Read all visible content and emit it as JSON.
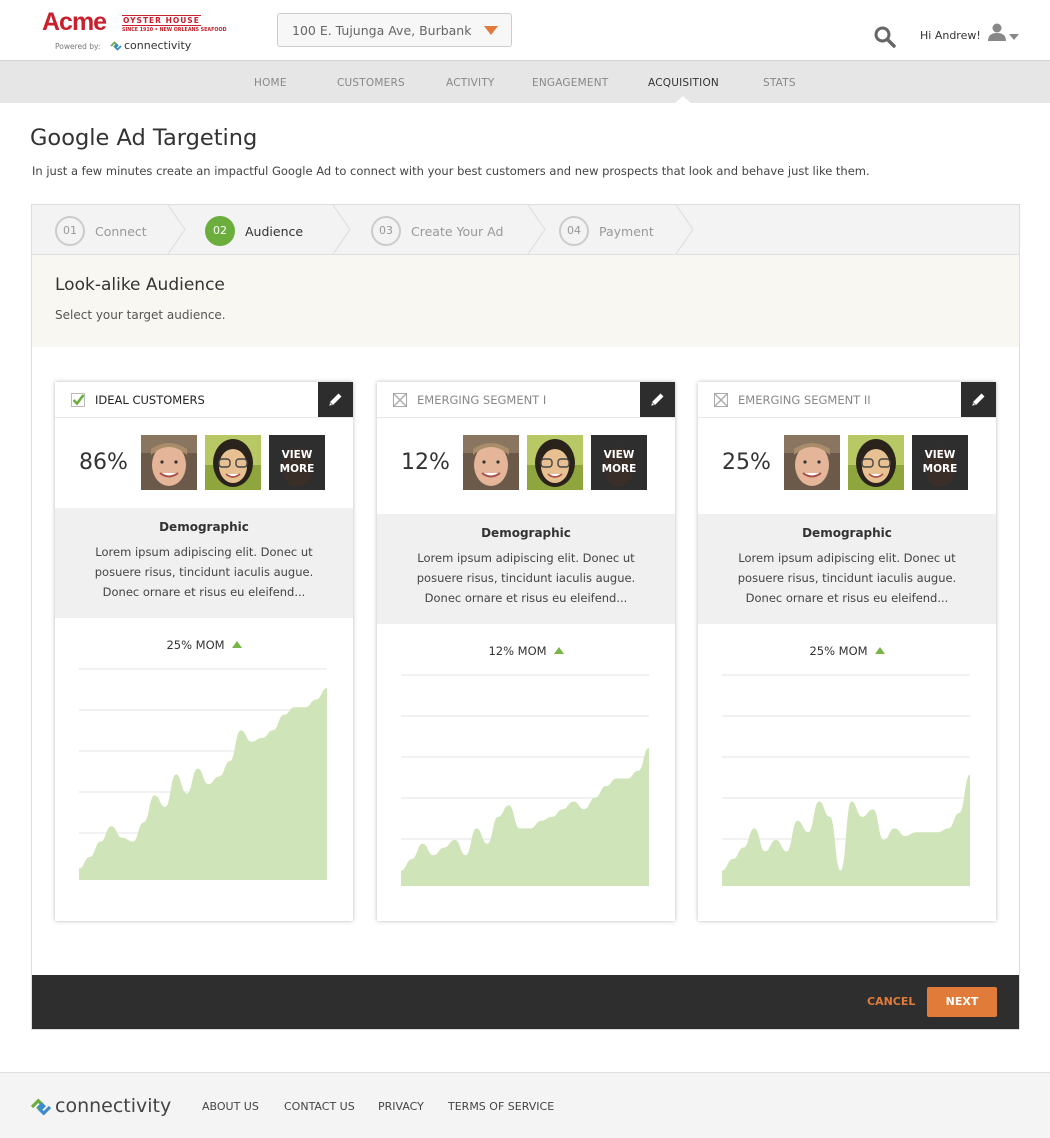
{
  "brand": {
    "name": "Acme",
    "tagline": "OYSTER HOUSE",
    "subtagline": "SINCE 1910 • NEW ORLEANS SEAFOOD",
    "powered_by": "Powered by:",
    "partner": "connectivity"
  },
  "location": {
    "value": "100 E. Tujunga Ave, Burbank"
  },
  "user": {
    "greeting": "Hi Andrew!"
  },
  "nav": {
    "items": [
      {
        "label": "HOME"
      },
      {
        "label": "CUSTOMERS"
      },
      {
        "label": "ACTIVITY"
      },
      {
        "label": "ENGAGEMENT"
      },
      {
        "label": "ACQUISITION"
      },
      {
        "label": "STATS"
      }
    ],
    "active": "ACQUISITION"
  },
  "page": {
    "title": "Google Ad Targeting",
    "description": "In just a few minutes create an impactful Google Ad to connect with your best customers and new prospects that look and behave just like them."
  },
  "steps": [
    {
      "num": "01",
      "label": "Connect"
    },
    {
      "num": "02",
      "label": "Audience",
      "active": true
    },
    {
      "num": "03",
      "label": "Create Your Ad"
    },
    {
      "num": "04",
      "label": "Payment"
    }
  ],
  "audience": {
    "title": "Look-alike Audience",
    "subtitle": "Select your target audience."
  },
  "cards": [
    {
      "title": "IDEAL CUSTOMERS",
      "checked": true,
      "percent": "86%",
      "view_more": "VIEW MORE",
      "demo_title": "Demographic",
      "demo_text": "Lorem ipsum adipiscing elit. Donec ut posuere risus, tincidunt iaculis augue. Donec ornare et risus eu eleifend...",
      "mom": "25% MOM",
      "trend": [
        0.06,
        0.12,
        0.2,
        0.28,
        0.22,
        0.2,
        0.3,
        0.44,
        0.38,
        0.55,
        0.45,
        0.58,
        0.5,
        0.54,
        0.62,
        0.78,
        0.72,
        0.74,
        0.78,
        0.86,
        0.9,
        0.9,
        0.94,
        1.0
      ]
    },
    {
      "title": "EMERGING SEGMENT I",
      "checked": false,
      "percent": "12%",
      "view_more": "VIEW MORE",
      "demo_title": "Demographic",
      "demo_text": "Lorem ipsum adipiscing elit. Donec ut posuere risus, tincidunt iaculis augue. Donec ornare et risus eu eleifend...",
      "mom": "12% MOM",
      "trend": [
        0.08,
        0.14,
        0.22,
        0.16,
        0.2,
        0.24,
        0.16,
        0.3,
        0.22,
        0.36,
        0.42,
        0.3,
        0.3,
        0.34,
        0.36,
        0.4,
        0.44,
        0.4,
        0.46,
        0.52,
        0.56,
        0.56,
        0.6,
        0.72
      ]
    },
    {
      "title": "EMERGING SEGMENT II",
      "checked": false,
      "percent": "25%",
      "view_more": "VIEW MORE",
      "demo_title": "Demographic",
      "demo_text": "Lorem ipsum adipiscing elit. Donec ut posuere risus, tincidunt iaculis augue. Donec ornare et risus eu eleifend...",
      "mom": "25% MOM",
      "trend": [
        0.08,
        0.14,
        0.2,
        0.3,
        0.18,
        0.24,
        0.18,
        0.34,
        0.28,
        0.44,
        0.36,
        0.08,
        0.44,
        0.36,
        0.4,
        0.24,
        0.3,
        0.26,
        0.28,
        0.28,
        0.28,
        0.3,
        0.38,
        0.58
      ]
    }
  ],
  "actions": {
    "cancel": "CANCEL",
    "next": "NEXT"
  },
  "footer": {
    "brand": "connectivity",
    "links": [
      "ABOUT US",
      "CONTACT US",
      "PRIVACY",
      "TERMS OF SERVICE"
    ]
  },
  "colors": {
    "brand_red": "#c8202c",
    "accent_orange": "#e07b39",
    "active_green": "#6cae3e",
    "chart_fill": "#cfe4b8"
  },
  "icons": [
    "search-icon",
    "user-icon",
    "chevron-down-icon",
    "pencil-icon",
    "checkbox-checked-icon",
    "checkbox-unchecked-icon",
    "trend-up-icon",
    "connectivity-logo-icon"
  ]
}
